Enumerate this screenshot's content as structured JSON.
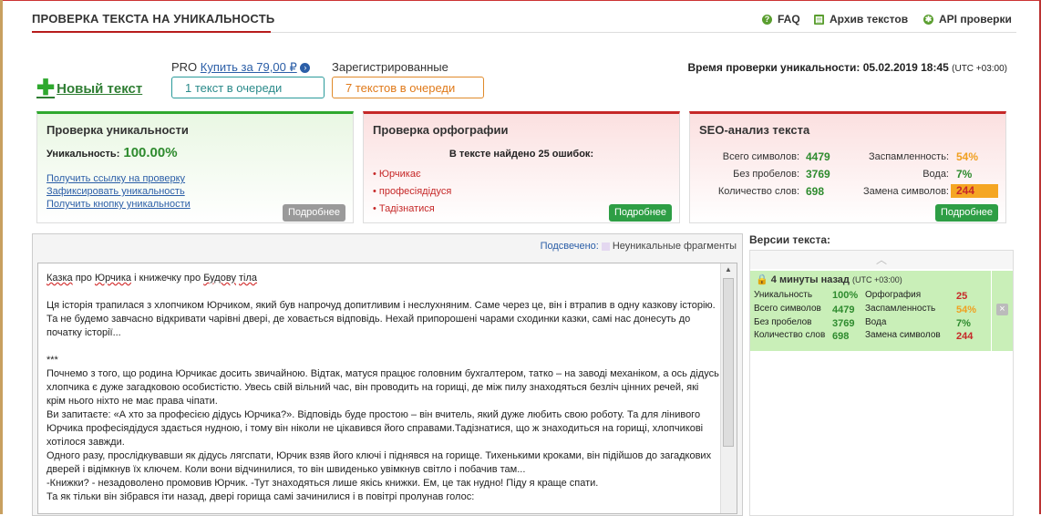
{
  "header": {
    "title": "ПРОВЕРКА ТЕКСТА НА УНИКАЛЬНОСТЬ",
    "links": [
      {
        "icon": "question-icon",
        "label": "FAQ"
      },
      {
        "icon": "archive-icon",
        "label": "Архив текстов"
      },
      {
        "icon": "gear-icon",
        "label": "API проверки"
      }
    ]
  },
  "toolbar": {
    "new_text": "Новый текст",
    "pro_label": "PRO",
    "buy_link": "Купить за 79,00 ₽",
    "registered_label": "Зарегистрированные",
    "queue_pro": "1 текст в очереди",
    "queue_registered": "7 текстов в очереди",
    "check_time_label": "Время проверки уникальности: 05.02.2019 18:45",
    "check_time_tz": "(UTC +03:00)"
  },
  "uniqueness": {
    "title": "Проверка уникальности",
    "label": "Уникальность:",
    "value": "100.00%",
    "links": [
      "Получить ссылку на проверку",
      "Зафиксировать уникальность",
      "Получить кнопку уникальности"
    ],
    "more": "Подробнее"
  },
  "spelling": {
    "title": "Проверка орфографии",
    "summary": "В тексте найдено 25 ошибок:",
    "errors": [
      "Юрчикає",
      "професіядідуся",
      "Тадізнатися"
    ],
    "more": "Подробнее"
  },
  "seo": {
    "title": "SEO-анализ текста",
    "total_chars_label": "Всего символов:",
    "total_chars": "4479",
    "no_spaces_label": "Без пробелов:",
    "no_spaces": "3769",
    "words_label": "Количество слов:",
    "words": "698",
    "spam_label": "Заспамленность:",
    "spam": "54%",
    "water_label": "Вода:",
    "water": "7%",
    "replace_label": "Замена символов:",
    "replace": "244",
    "more": "Подробнее",
    "colors": {
      "green": "#2e8b2e",
      "orange": "#f0a020",
      "replace_bg": "#f5a623",
      "replace_fg": "#c62828"
    }
  },
  "editor": {
    "highlight_label": "Подсвечено:",
    "highlight_legend": "Неуникальные фрагменты",
    "title_words": [
      "Казка",
      "про",
      "Юрчика",
      "і книжечку про",
      "Будову",
      "тіла"
    ],
    "paragraphs": [
      "Ця історія трапилася з хлопчиком Юрчиком, який був напрочуд допитливим і неслухняним. Саме через це, він і втрапив в одну казкову історію. Та не будемо завчасно відкривати чарівні двері, де ховається відповідь. Нехай припорошені чарами сходинки казки, самі нас донесуть до початку історії...",
      "***",
      "Почнемо з того, що родина Юрчикає досить звичайною. Відтак, матуся працює головним бухгалтером, татко – на заводі механіком, а ось дідусь хлопчика є дуже загадковою особистістю. Увесь свій вільний час, він проводить на горищі, де між пилу знаходяться безліч цінних речей, які крім нього ніхто не має права чіпати.",
      "Ви запитаєте: «А хто за професією дідусь Юрчика?». Відповідь буде простою – він вчитель, який дуже любить свою роботу. Та для лінивого Юрчика професіядідуся здається нудною, і тому він ніколи не цікавився його справами.Тадізнатися, що ж знаходиться на горищі, хлопчикові хотілося завжди.",
      "Одного разу, прослідкувавши як дідусь лягспати, Юрчик взяв його ключі і піднявся на горище. Тихенькими кроками, він підійшов до загадкових дверей і відімкнув їх ключем. Коли вони відчинилися, то він швиденько увімкнув світло і побачив там...",
      "-Книжки? - незадоволено промовив Юрчик. -Тут знаходяться лише якісь книжки. Ем, це так нудно! Піду я краще спати.",
      "Та як тільки він зібрався іти назад, двері горища самі зачинилися і в повітрі пролунав голос:"
    ]
  },
  "versions": {
    "title": "Версии текста:",
    "entry": {
      "time": "4 минуты назад",
      "tz": "(UTC +03:00)",
      "uniq_label": "Уникальность",
      "uniq": "100%",
      "chars_label": "Всего символов",
      "chars": "4479",
      "nospace_label": "Без пробелов",
      "nospace": "3769",
      "words_label": "Количество слов",
      "words": "698",
      "spell_label": "Орфография",
      "spell": "25",
      "spam_label": "Заспамленность",
      "spam": "54%",
      "water_label": "Вода",
      "water": "7%",
      "replace_label": "Замена символов",
      "replace": "244"
    }
  }
}
